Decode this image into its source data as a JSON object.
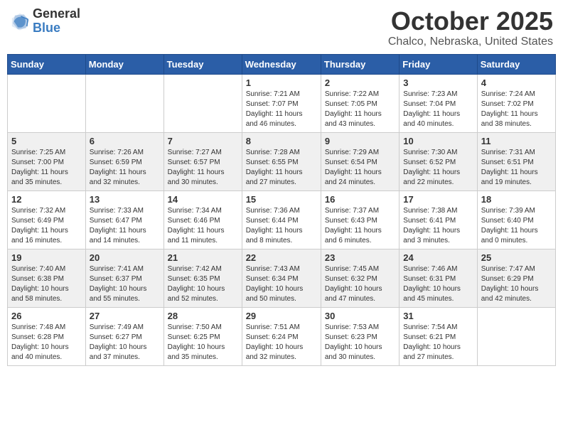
{
  "header": {
    "logo_general": "General",
    "logo_blue": "Blue",
    "month_title": "October 2025",
    "location": "Chalco, Nebraska, United States"
  },
  "weekdays": [
    "Sunday",
    "Monday",
    "Tuesday",
    "Wednesday",
    "Thursday",
    "Friday",
    "Saturday"
  ],
  "weeks": [
    [
      {
        "num": "",
        "info": ""
      },
      {
        "num": "",
        "info": ""
      },
      {
        "num": "",
        "info": ""
      },
      {
        "num": "1",
        "info": "Sunrise: 7:21 AM\nSunset: 7:07 PM\nDaylight: 11 hours\nand 46 minutes."
      },
      {
        "num": "2",
        "info": "Sunrise: 7:22 AM\nSunset: 7:05 PM\nDaylight: 11 hours\nand 43 minutes."
      },
      {
        "num": "3",
        "info": "Sunrise: 7:23 AM\nSunset: 7:04 PM\nDaylight: 11 hours\nand 40 minutes."
      },
      {
        "num": "4",
        "info": "Sunrise: 7:24 AM\nSunset: 7:02 PM\nDaylight: 11 hours\nand 38 minutes."
      }
    ],
    [
      {
        "num": "5",
        "info": "Sunrise: 7:25 AM\nSunset: 7:00 PM\nDaylight: 11 hours\nand 35 minutes."
      },
      {
        "num": "6",
        "info": "Sunrise: 7:26 AM\nSunset: 6:59 PM\nDaylight: 11 hours\nand 32 minutes."
      },
      {
        "num": "7",
        "info": "Sunrise: 7:27 AM\nSunset: 6:57 PM\nDaylight: 11 hours\nand 30 minutes."
      },
      {
        "num": "8",
        "info": "Sunrise: 7:28 AM\nSunset: 6:55 PM\nDaylight: 11 hours\nand 27 minutes."
      },
      {
        "num": "9",
        "info": "Sunrise: 7:29 AM\nSunset: 6:54 PM\nDaylight: 11 hours\nand 24 minutes."
      },
      {
        "num": "10",
        "info": "Sunrise: 7:30 AM\nSunset: 6:52 PM\nDaylight: 11 hours\nand 22 minutes."
      },
      {
        "num": "11",
        "info": "Sunrise: 7:31 AM\nSunset: 6:51 PM\nDaylight: 11 hours\nand 19 minutes."
      }
    ],
    [
      {
        "num": "12",
        "info": "Sunrise: 7:32 AM\nSunset: 6:49 PM\nDaylight: 11 hours\nand 16 minutes."
      },
      {
        "num": "13",
        "info": "Sunrise: 7:33 AM\nSunset: 6:47 PM\nDaylight: 11 hours\nand 14 minutes."
      },
      {
        "num": "14",
        "info": "Sunrise: 7:34 AM\nSunset: 6:46 PM\nDaylight: 11 hours\nand 11 minutes."
      },
      {
        "num": "15",
        "info": "Sunrise: 7:36 AM\nSunset: 6:44 PM\nDaylight: 11 hours\nand 8 minutes."
      },
      {
        "num": "16",
        "info": "Sunrise: 7:37 AM\nSunset: 6:43 PM\nDaylight: 11 hours\nand 6 minutes."
      },
      {
        "num": "17",
        "info": "Sunrise: 7:38 AM\nSunset: 6:41 PM\nDaylight: 11 hours\nand 3 minutes."
      },
      {
        "num": "18",
        "info": "Sunrise: 7:39 AM\nSunset: 6:40 PM\nDaylight: 11 hours\nand 0 minutes."
      }
    ],
    [
      {
        "num": "19",
        "info": "Sunrise: 7:40 AM\nSunset: 6:38 PM\nDaylight: 10 hours\nand 58 minutes."
      },
      {
        "num": "20",
        "info": "Sunrise: 7:41 AM\nSunset: 6:37 PM\nDaylight: 10 hours\nand 55 minutes."
      },
      {
        "num": "21",
        "info": "Sunrise: 7:42 AM\nSunset: 6:35 PM\nDaylight: 10 hours\nand 52 minutes."
      },
      {
        "num": "22",
        "info": "Sunrise: 7:43 AM\nSunset: 6:34 PM\nDaylight: 10 hours\nand 50 minutes."
      },
      {
        "num": "23",
        "info": "Sunrise: 7:45 AM\nSunset: 6:32 PM\nDaylight: 10 hours\nand 47 minutes."
      },
      {
        "num": "24",
        "info": "Sunrise: 7:46 AM\nSunset: 6:31 PM\nDaylight: 10 hours\nand 45 minutes."
      },
      {
        "num": "25",
        "info": "Sunrise: 7:47 AM\nSunset: 6:29 PM\nDaylight: 10 hours\nand 42 minutes."
      }
    ],
    [
      {
        "num": "26",
        "info": "Sunrise: 7:48 AM\nSunset: 6:28 PM\nDaylight: 10 hours\nand 40 minutes."
      },
      {
        "num": "27",
        "info": "Sunrise: 7:49 AM\nSunset: 6:27 PM\nDaylight: 10 hours\nand 37 minutes."
      },
      {
        "num": "28",
        "info": "Sunrise: 7:50 AM\nSunset: 6:25 PM\nDaylight: 10 hours\nand 35 minutes."
      },
      {
        "num": "29",
        "info": "Sunrise: 7:51 AM\nSunset: 6:24 PM\nDaylight: 10 hours\nand 32 minutes."
      },
      {
        "num": "30",
        "info": "Sunrise: 7:53 AM\nSunset: 6:23 PM\nDaylight: 10 hours\nand 30 minutes."
      },
      {
        "num": "31",
        "info": "Sunrise: 7:54 AM\nSunset: 6:21 PM\nDaylight: 10 hours\nand 27 minutes."
      },
      {
        "num": "",
        "info": ""
      }
    ]
  ]
}
